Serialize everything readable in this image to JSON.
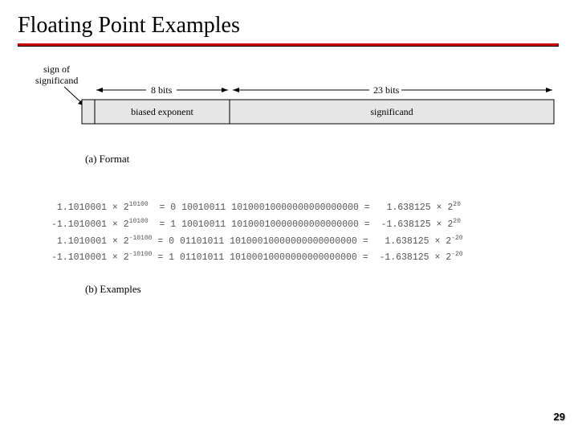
{
  "title": "Floating Point Examples",
  "diagram": {
    "sign_label_line1": "sign of",
    "sign_label_line2": "significand",
    "span_exp": "8 bits",
    "span_sig": "23 bits",
    "box_exp": "biased exponent",
    "box_sig": "significand"
  },
  "caption_a": "(a) Format",
  "examples": {
    "rows": [
      {
        "lhs_sign": " ",
        "lhs_mant": "1.1010001",
        "lhs_exp": "10100",
        "mid": "= 0 10010011 10100010000000000000000 =",
        "rhs_sign": " ",
        "rhs_val": "1.638125",
        "rhs_exp": "20"
      },
      {
        "lhs_sign": "-",
        "lhs_mant": "1.1010001",
        "lhs_exp": "10100",
        "mid": "= 1 10010011 10100010000000000000000 =",
        "rhs_sign": "-",
        "rhs_val": "1.638125",
        "rhs_exp": "20"
      },
      {
        "lhs_sign": " ",
        "lhs_mant": "1.1010001",
        "lhs_exp": "-10100",
        "mid": "= 0 01101011 10100010000000000000000 =",
        "rhs_sign": " ",
        "rhs_val": "1.638125",
        "rhs_exp": "-20"
      },
      {
        "lhs_sign": "-",
        "lhs_mant": "1.1010001",
        "lhs_exp": "-10100",
        "mid": "= 1 01101011 10100010000000000000000 =",
        "rhs_sign": "-",
        "rhs_val": "1.638125",
        "rhs_exp": "-20"
      }
    ]
  },
  "caption_b": "(b) Examples",
  "page_number": "29",
  "chart_data": {
    "type": "table",
    "title": "Floating point 32-bit format examples",
    "format_fields": [
      {
        "name": "sign",
        "bits": 1
      },
      {
        "name": "biased exponent",
        "bits": 8
      },
      {
        "name": "significand",
        "bits": 23
      }
    ],
    "rows": [
      {
        "binary_value": "1.1010001",
        "binary_exponent": "10100",
        "sign_bit": 0,
        "exponent_bits": "10010011",
        "significand_bits": "10100010000000000000000",
        "decimal_value": 1.638125,
        "decimal_exponent": 20
      },
      {
        "binary_value": "-1.1010001",
        "binary_exponent": "10100",
        "sign_bit": 1,
        "exponent_bits": "10010011",
        "significand_bits": "10100010000000000000000",
        "decimal_value": -1.638125,
        "decimal_exponent": 20
      },
      {
        "binary_value": "1.1010001",
        "binary_exponent": "-10100",
        "sign_bit": 0,
        "exponent_bits": "01101011",
        "significand_bits": "10100010000000000000000",
        "decimal_value": 1.638125,
        "decimal_exponent": -20
      },
      {
        "binary_value": "-1.1010001",
        "binary_exponent": "-10100",
        "sign_bit": 1,
        "exponent_bits": "01101011",
        "significand_bits": "10100010000000000000000",
        "decimal_value": -1.638125,
        "decimal_exponent": -20
      }
    ]
  }
}
